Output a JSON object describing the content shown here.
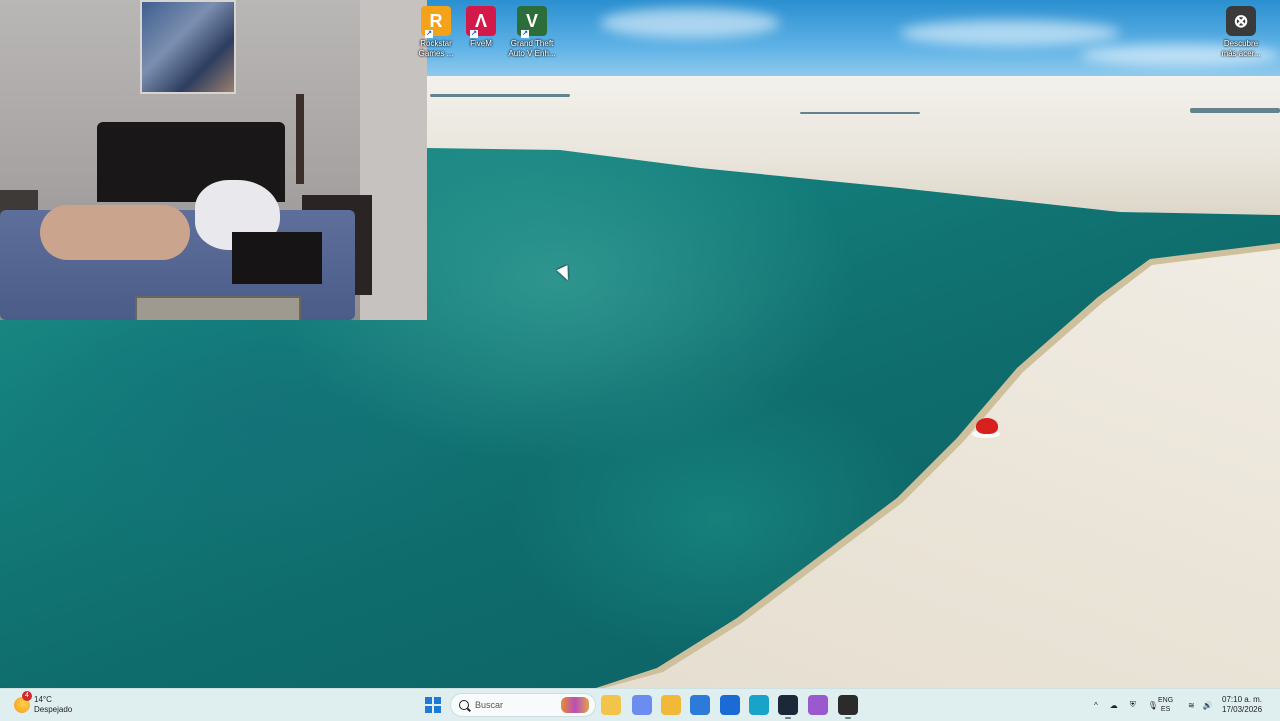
{
  "desktop": {
    "icons": [
      {
        "name": "rockstar-launcher-icon",
        "label": "Rockstar\nGames ...",
        "color": "#f5a21b",
        "glyph": "R"
      },
      {
        "name": "fivem-icon",
        "label": "FiveM",
        "color": "#d3194a",
        "glyph": "Λ"
      },
      {
        "name": "gta-v-icon",
        "label": "Grand Theft\nAuto V Enh...",
        "color": "#2c6e3a",
        "glyph": "V"
      },
      {
        "name": "discover-more-icon",
        "label": "Descubre\nmás acer...",
        "color": "#3a3a3a",
        "glyph": "⊗"
      }
    ]
  },
  "taskbar": {
    "weather": {
      "temp": "14°C",
      "condition": "Despejado",
      "badge": "4"
    },
    "search_placeholder": "Buscar",
    "apps": [
      {
        "name": "file-explorer-app",
        "color": "#f3c44a"
      },
      {
        "name": "copilot-app",
        "color": "#6b8df0"
      },
      {
        "name": "folder-app",
        "color": "#f1b93a"
      },
      {
        "name": "store-app",
        "color": "#2c7bd8"
      },
      {
        "name": "outlook-app",
        "color": "#1a6bd4"
      },
      {
        "name": "edge-app",
        "color": "#1aa3c8"
      },
      {
        "name": "steam-app",
        "color": "#1b2838"
      },
      {
        "name": "game-controller-app",
        "color": "#9b59d0"
      },
      {
        "name": "obs-app",
        "color": "#2b2b2b"
      }
    ],
    "lang_primary": "ENG",
    "lang_secondary": "ES",
    "time": "07:10 a. m.",
    "date": "17/03/2026"
  }
}
